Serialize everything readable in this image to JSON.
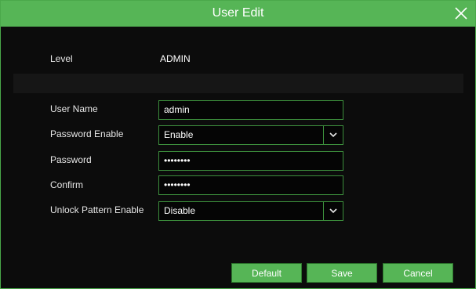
{
  "dialog": {
    "title": "User Edit"
  },
  "level": {
    "label": "Level",
    "value": "ADMIN"
  },
  "form": {
    "user_name": {
      "label": "User Name",
      "value": "admin"
    },
    "password_enable": {
      "label": "Password Enable",
      "value": "Enable"
    },
    "password": {
      "label": "Password",
      "value": "••••••••"
    },
    "confirm": {
      "label": "Confirm",
      "value": "••••••••"
    },
    "unlock_pattern_enable": {
      "label": "Unlock Pattern Enable",
      "value": "Disable"
    }
  },
  "buttons": {
    "default": "Default",
    "save": "Save",
    "cancel": "Cancel"
  },
  "colors": {
    "accent": "#56b556",
    "field_border": "#3c8e3c",
    "background": "#0c0c0c"
  },
  "icons": {
    "close": "close-icon",
    "dropdown": "chevron-down-icon"
  }
}
